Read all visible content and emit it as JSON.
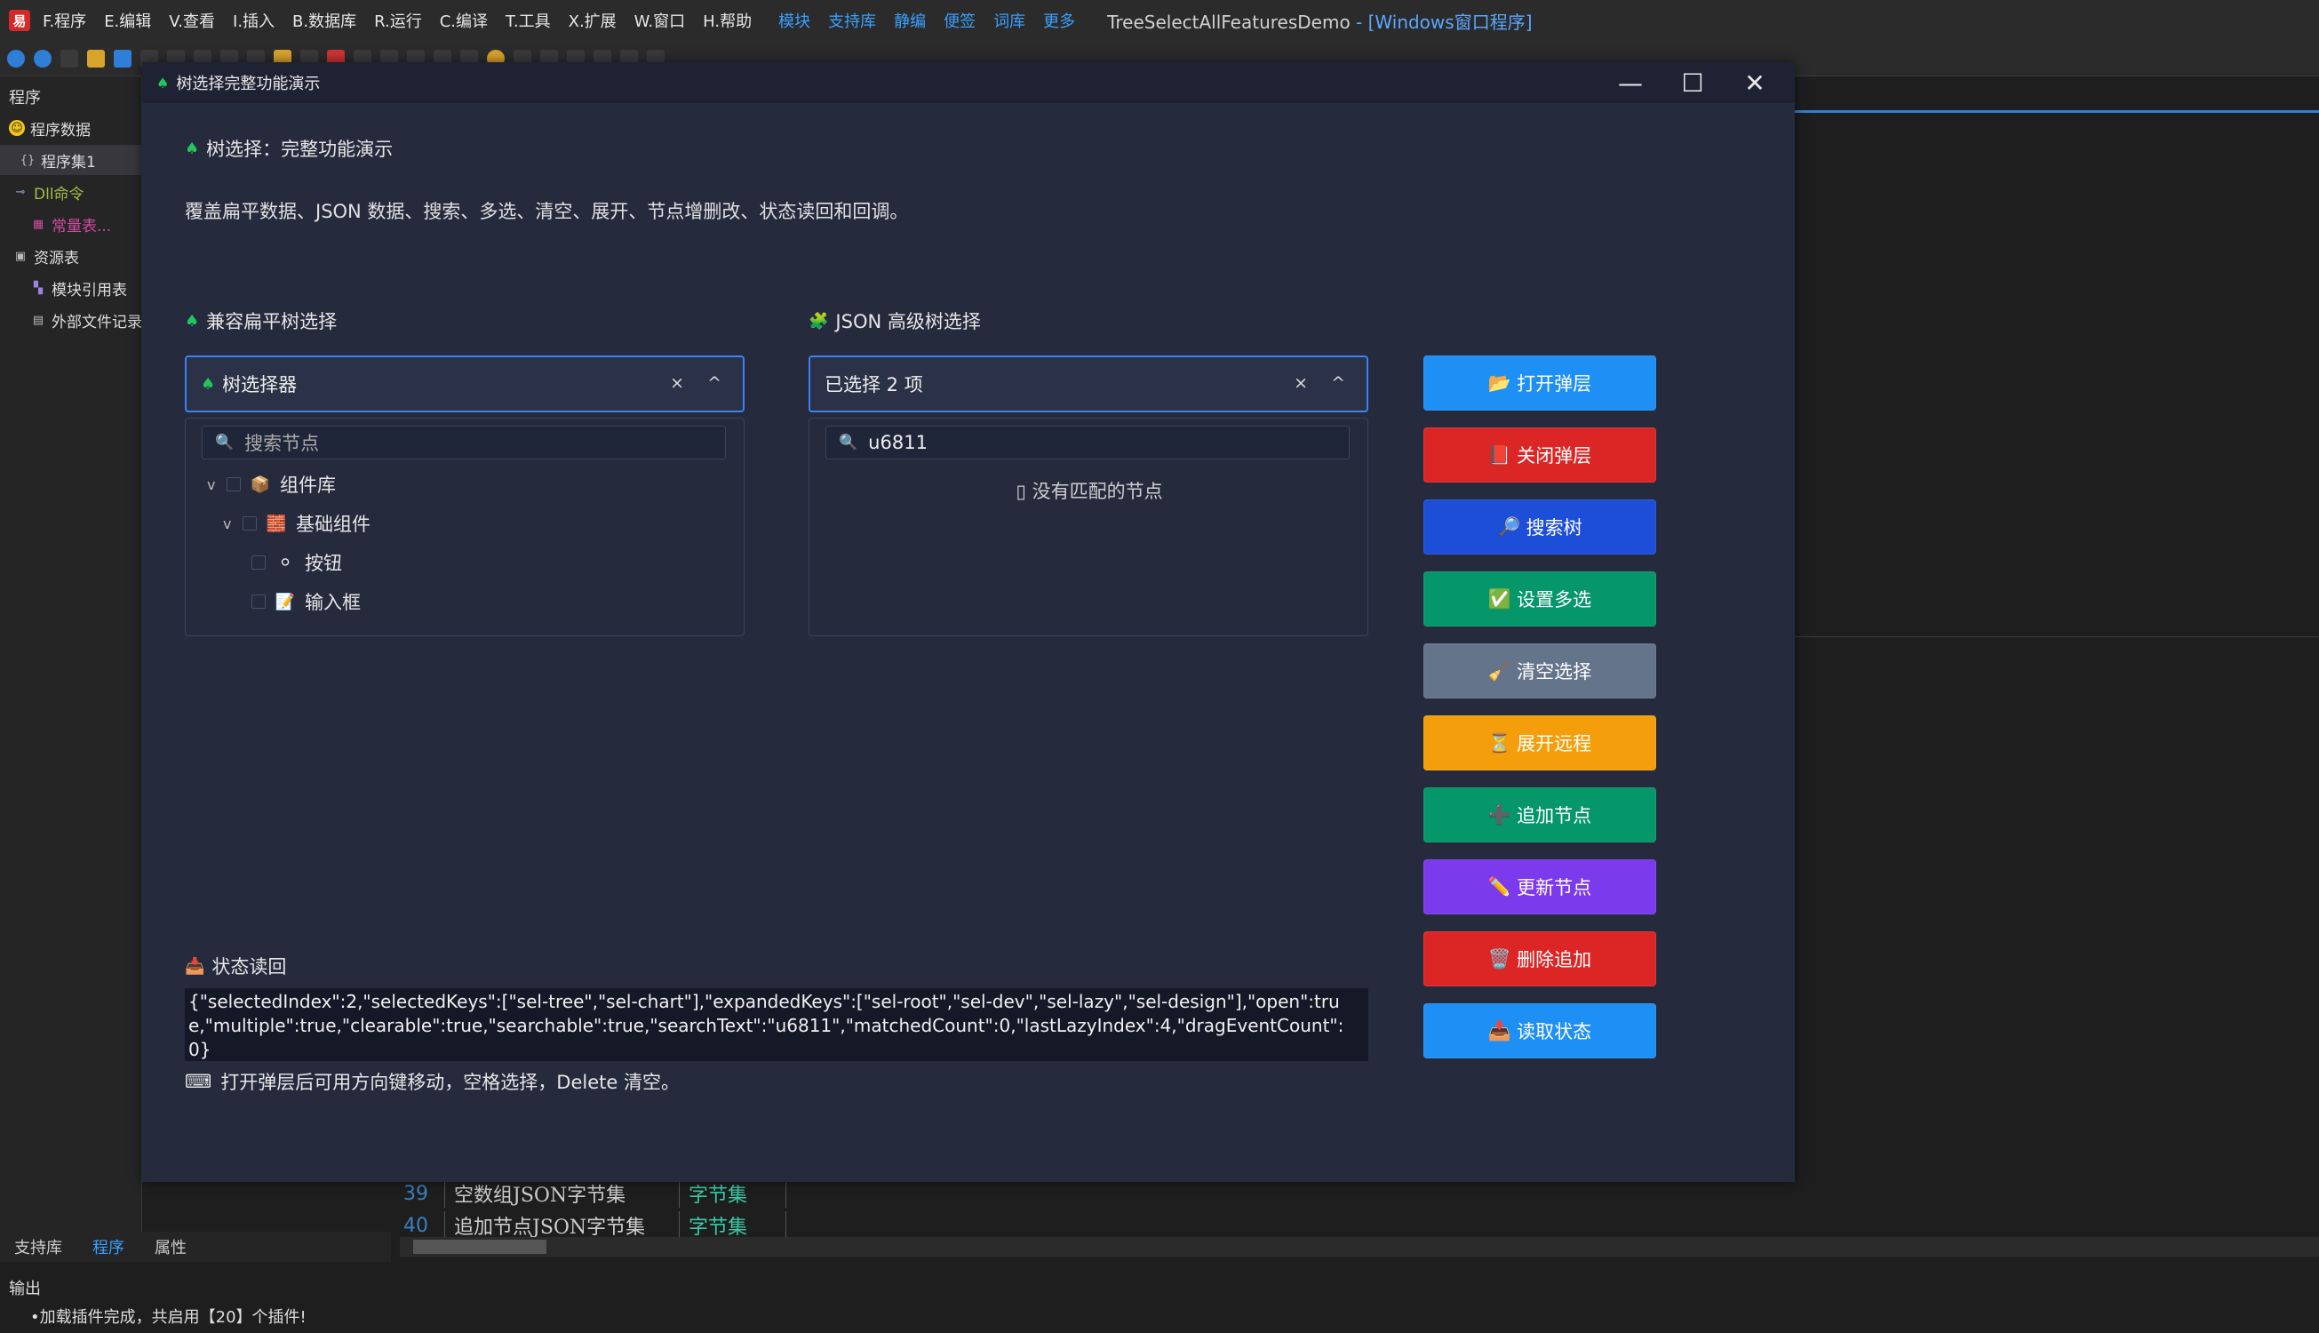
{
  "ide": {
    "logo": "易",
    "menus": [
      "F.程序",
      "E.编辑",
      "V.查看",
      "I.插入",
      "B.数据库",
      "R.运行",
      "C.编译",
      "T.工具",
      "X.扩展",
      "W.窗口",
      "H.帮助"
    ],
    "links": [
      "模块",
      "支持库",
      "静编",
      "便签",
      "词库",
      "更多"
    ],
    "title": "TreeSelectAllFeaturesDemo",
    "title_suffix": " - [Windows窗口程序]",
    "left_panel_title": "程序",
    "tree": [
      {
        "label": "程序数据",
        "icon": "smiley-icon",
        "color": "#f5c518"
      },
      {
        "label": "程序集1",
        "icon": "braces-icon",
        "color": "#bbb"
      },
      {
        "label": "Dll命令",
        "icon": "link-icon",
        "color": "#a0c040"
      },
      {
        "label": "常量表...",
        "icon": "table-icon",
        "color": "#d04aa0"
      },
      {
        "label": "资源表",
        "icon": "resource-icon",
        "color": "#bbb"
      },
      {
        "label": "模块引用表",
        "icon": "module-icon",
        "color": "#a080e0"
      },
      {
        "label": "外部文件记录",
        "icon": "file-icon",
        "color": "#bbb"
      }
    ],
    "grid_rows": [
      {
        "num": "39",
        "name": "空数组JSON字节集",
        "type": "字节集"
      },
      {
        "num": "40",
        "name": "追加节点JSON字节集",
        "type": "字节集"
      }
    ],
    "bottom_tabs": [
      "支持库",
      "程序",
      "属性"
    ],
    "output_title": "输出",
    "output_line": "•加载插件完成，共启用【20】个插件!"
  },
  "dialog": {
    "title": "树选择完整功能演示",
    "heading": "树选择：完整功能演示",
    "description": "覆盖扁平数据、JSON 数据、搜索、多选、清空、展开、节点增删改、状态读回和回调。",
    "left": {
      "section_title": "兼容扁平树选择",
      "select_value": "树选择器",
      "controls": "× ^",
      "search_placeholder": "搜索节点",
      "nodes": [
        {
          "label": "组件库",
          "chevron": "v"
        },
        {
          "label": "基础组件",
          "chevron": "v"
        },
        {
          "label": "按钮",
          "chevron": ""
        },
        {
          "label": "输入框",
          "chevron": ""
        }
      ]
    },
    "right": {
      "section_title": "JSON 高级树选择",
      "select_value": "已选择 2 项",
      "controls": "× ^",
      "search_value": "u6811",
      "empty_message": "▯ 没有匹配的节点"
    },
    "actions": [
      {
        "label": "打开弹层",
        "icon": "folder-icon",
        "glyph": "📂",
        "color": "#1e8ff5"
      },
      {
        "label": "关闭弹层",
        "icon": "book-icon",
        "glyph": "📕",
        "color": "#dc2626"
      },
      {
        "label": "搜索树",
        "icon": "search-icon",
        "glyph": "🔎",
        "color": "#1d4ed8"
      },
      {
        "label": "设置多选",
        "icon": "check-icon",
        "glyph": "✅",
        "color": "#059669"
      },
      {
        "label": "清空选择",
        "icon": "broom-icon",
        "glyph": "🧹",
        "color": "#64748b"
      },
      {
        "label": "展开远程",
        "icon": "hourglass-icon",
        "glyph": "⏳",
        "color": "#f59e0b"
      },
      {
        "label": "追加节点",
        "icon": "plus-icon",
        "glyph": "➕",
        "color": "#059669"
      },
      {
        "label": "更新节点",
        "icon": "pencil-icon",
        "glyph": "✏️",
        "color": "#7c3aed"
      },
      {
        "label": "删除追加",
        "icon": "trash-icon",
        "glyph": "🗑️",
        "color": "#dc2626"
      },
      {
        "label": "读取状态",
        "icon": "inbox-icon",
        "glyph": "📥",
        "color": "#1e8ff5"
      }
    ],
    "status_title": "状态读回",
    "status_text": "{\"selectedIndex\":2,\"selectedKeys\":[\"sel-tree\",\"sel-chart\"],\"expandedKeys\":[\"sel-root\",\"sel-dev\",\"sel-lazy\",\"sel-design\"],\"open\":true,\"multiple\":true,\"clearable\":true,\"searchable\":true,\"searchText\":\"u6811\",\"matchedCount\":0,\"lastLazyIndex\":4,\"dragEventCount\":0}",
    "hint": "打开弹层后可用方向键移动，空格选择，Delete 清空。"
  }
}
